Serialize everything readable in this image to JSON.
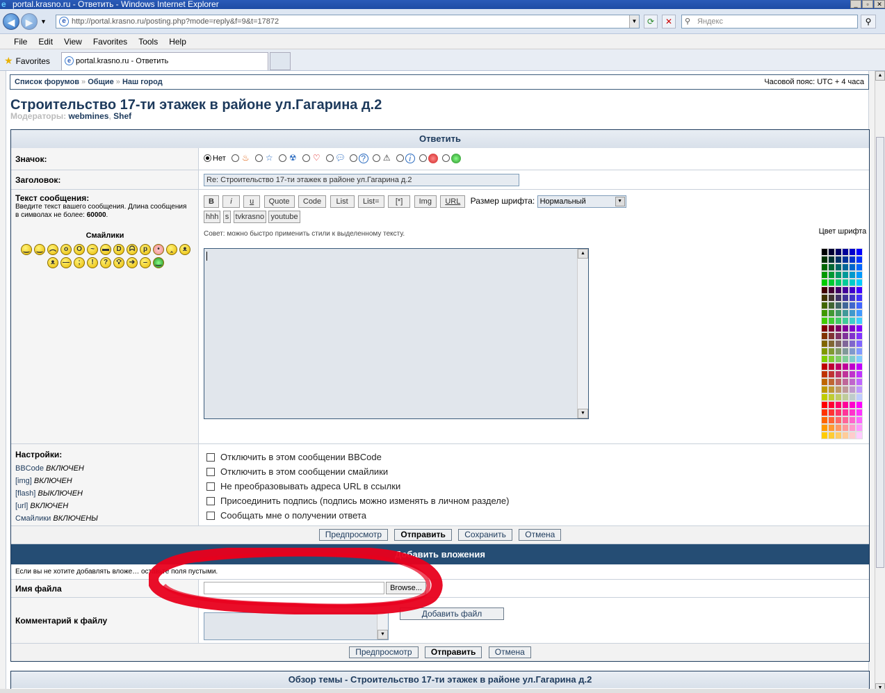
{
  "window": {
    "title": "portal.krasno.ru - Ответить - Windows Internet Explorer"
  },
  "browser": {
    "url": "http://portal.krasno.ru/posting.php?mode=reply&f=9&t=17872",
    "search_placeholder": "Яндекс",
    "menu": [
      "File",
      "Edit",
      "View",
      "Favorites",
      "Tools",
      "Help"
    ],
    "favorites_label": "Favorites",
    "tab_title": "portal.krasno.ru - Ответить"
  },
  "breadcrumb": {
    "items": [
      "Список форумов",
      "Общие",
      "Наш город"
    ],
    "separator": "»",
    "timezone": "Часовой пояс: UTC + 4 часа"
  },
  "topic": {
    "title": "Строительство 17-ти этажек в районе ул.Гагарина д.2",
    "moderators_label": "Модераторы:",
    "moderators": [
      "webmines",
      "Shef"
    ],
    "moderator_sep": ","
  },
  "reply": {
    "header": "Ответить",
    "icon_label": "Значок:",
    "icon_none": "Нет",
    "icons": [
      "fire-icon",
      "star-icon",
      "radiation-icon",
      "heart-icon",
      "speech-bubble-icon",
      "question-icon",
      "warning-icon",
      "info-icon",
      "red-face-icon",
      "green-face-icon"
    ],
    "subject_label": "Заголовок:",
    "subject_value": "Re: Строительство 17-ти этажек в районе ул.Гагарина д.2",
    "message_label": "Текст сообщения:",
    "message_hint_pre": "Введите текст вашего сообщения. Длина сообщения в символах не более:",
    "message_hint_limit": "60000",
    "message_hint_end": ".",
    "smilies_label": "Смайлики",
    "bbcode_buttons": [
      "B",
      "i",
      "u",
      "Quote",
      "Code",
      "List",
      "List=",
      "[*]",
      "Img",
      "URL"
    ],
    "font_size_label": "Размер шрифта:",
    "font_size_value": "Нормальный",
    "extra_buttons": [
      "hhh",
      "s",
      "tvkrasno",
      "youtube"
    ],
    "tip": "Совет: можно быстро применить стили к выделенному тексту.",
    "color_label": "Цвет шрифта",
    "settings_label": "Настройки:",
    "settings": [
      {
        "name": "BBCode",
        "state": "ВКЛЮЧЕН"
      },
      {
        "name": "[img]",
        "state": "ВКЛЮЧЕН"
      },
      {
        "name": "[flash]",
        "state": "ВЫКЛЮЧЕН"
      },
      {
        "name": "[url]",
        "state": "ВКЛЮЧЕН"
      },
      {
        "name": "Смайлики",
        "state": "ВКЛЮЧЕНЫ"
      }
    ],
    "options": [
      "Отключить в этом сообщении BBCode",
      "Отключить в этом сообщении смайлики",
      "Не преобразовывать адреса URL в ссылки",
      "Присоединить подпись (подпись можно изменять в личном разделе)",
      "Сообщать мне о получении ответа"
    ],
    "actions": [
      "Предпросмотр",
      "Отправить",
      "Сохранить",
      "Отмена"
    ]
  },
  "attach": {
    "header": "Добавить вложения",
    "hint": "Если вы не хотите добавлять вложе… оставьте поля пустыми.",
    "filename_label": "Имя файла",
    "browse": "Browse...",
    "comment_label": "Комментарий к файлу",
    "add_file": "Добавить файл",
    "actions": [
      "Предпросмотр",
      "Отправить",
      "Отмена"
    ]
  },
  "review": {
    "header": "Обзор темы - Строительство 17-ти этажек в районе ул.Гагарина д.2"
  },
  "colors": {
    "header_bar": "#254d74",
    "link": "#1d3a5c",
    "annotation": "#e8001c"
  }
}
